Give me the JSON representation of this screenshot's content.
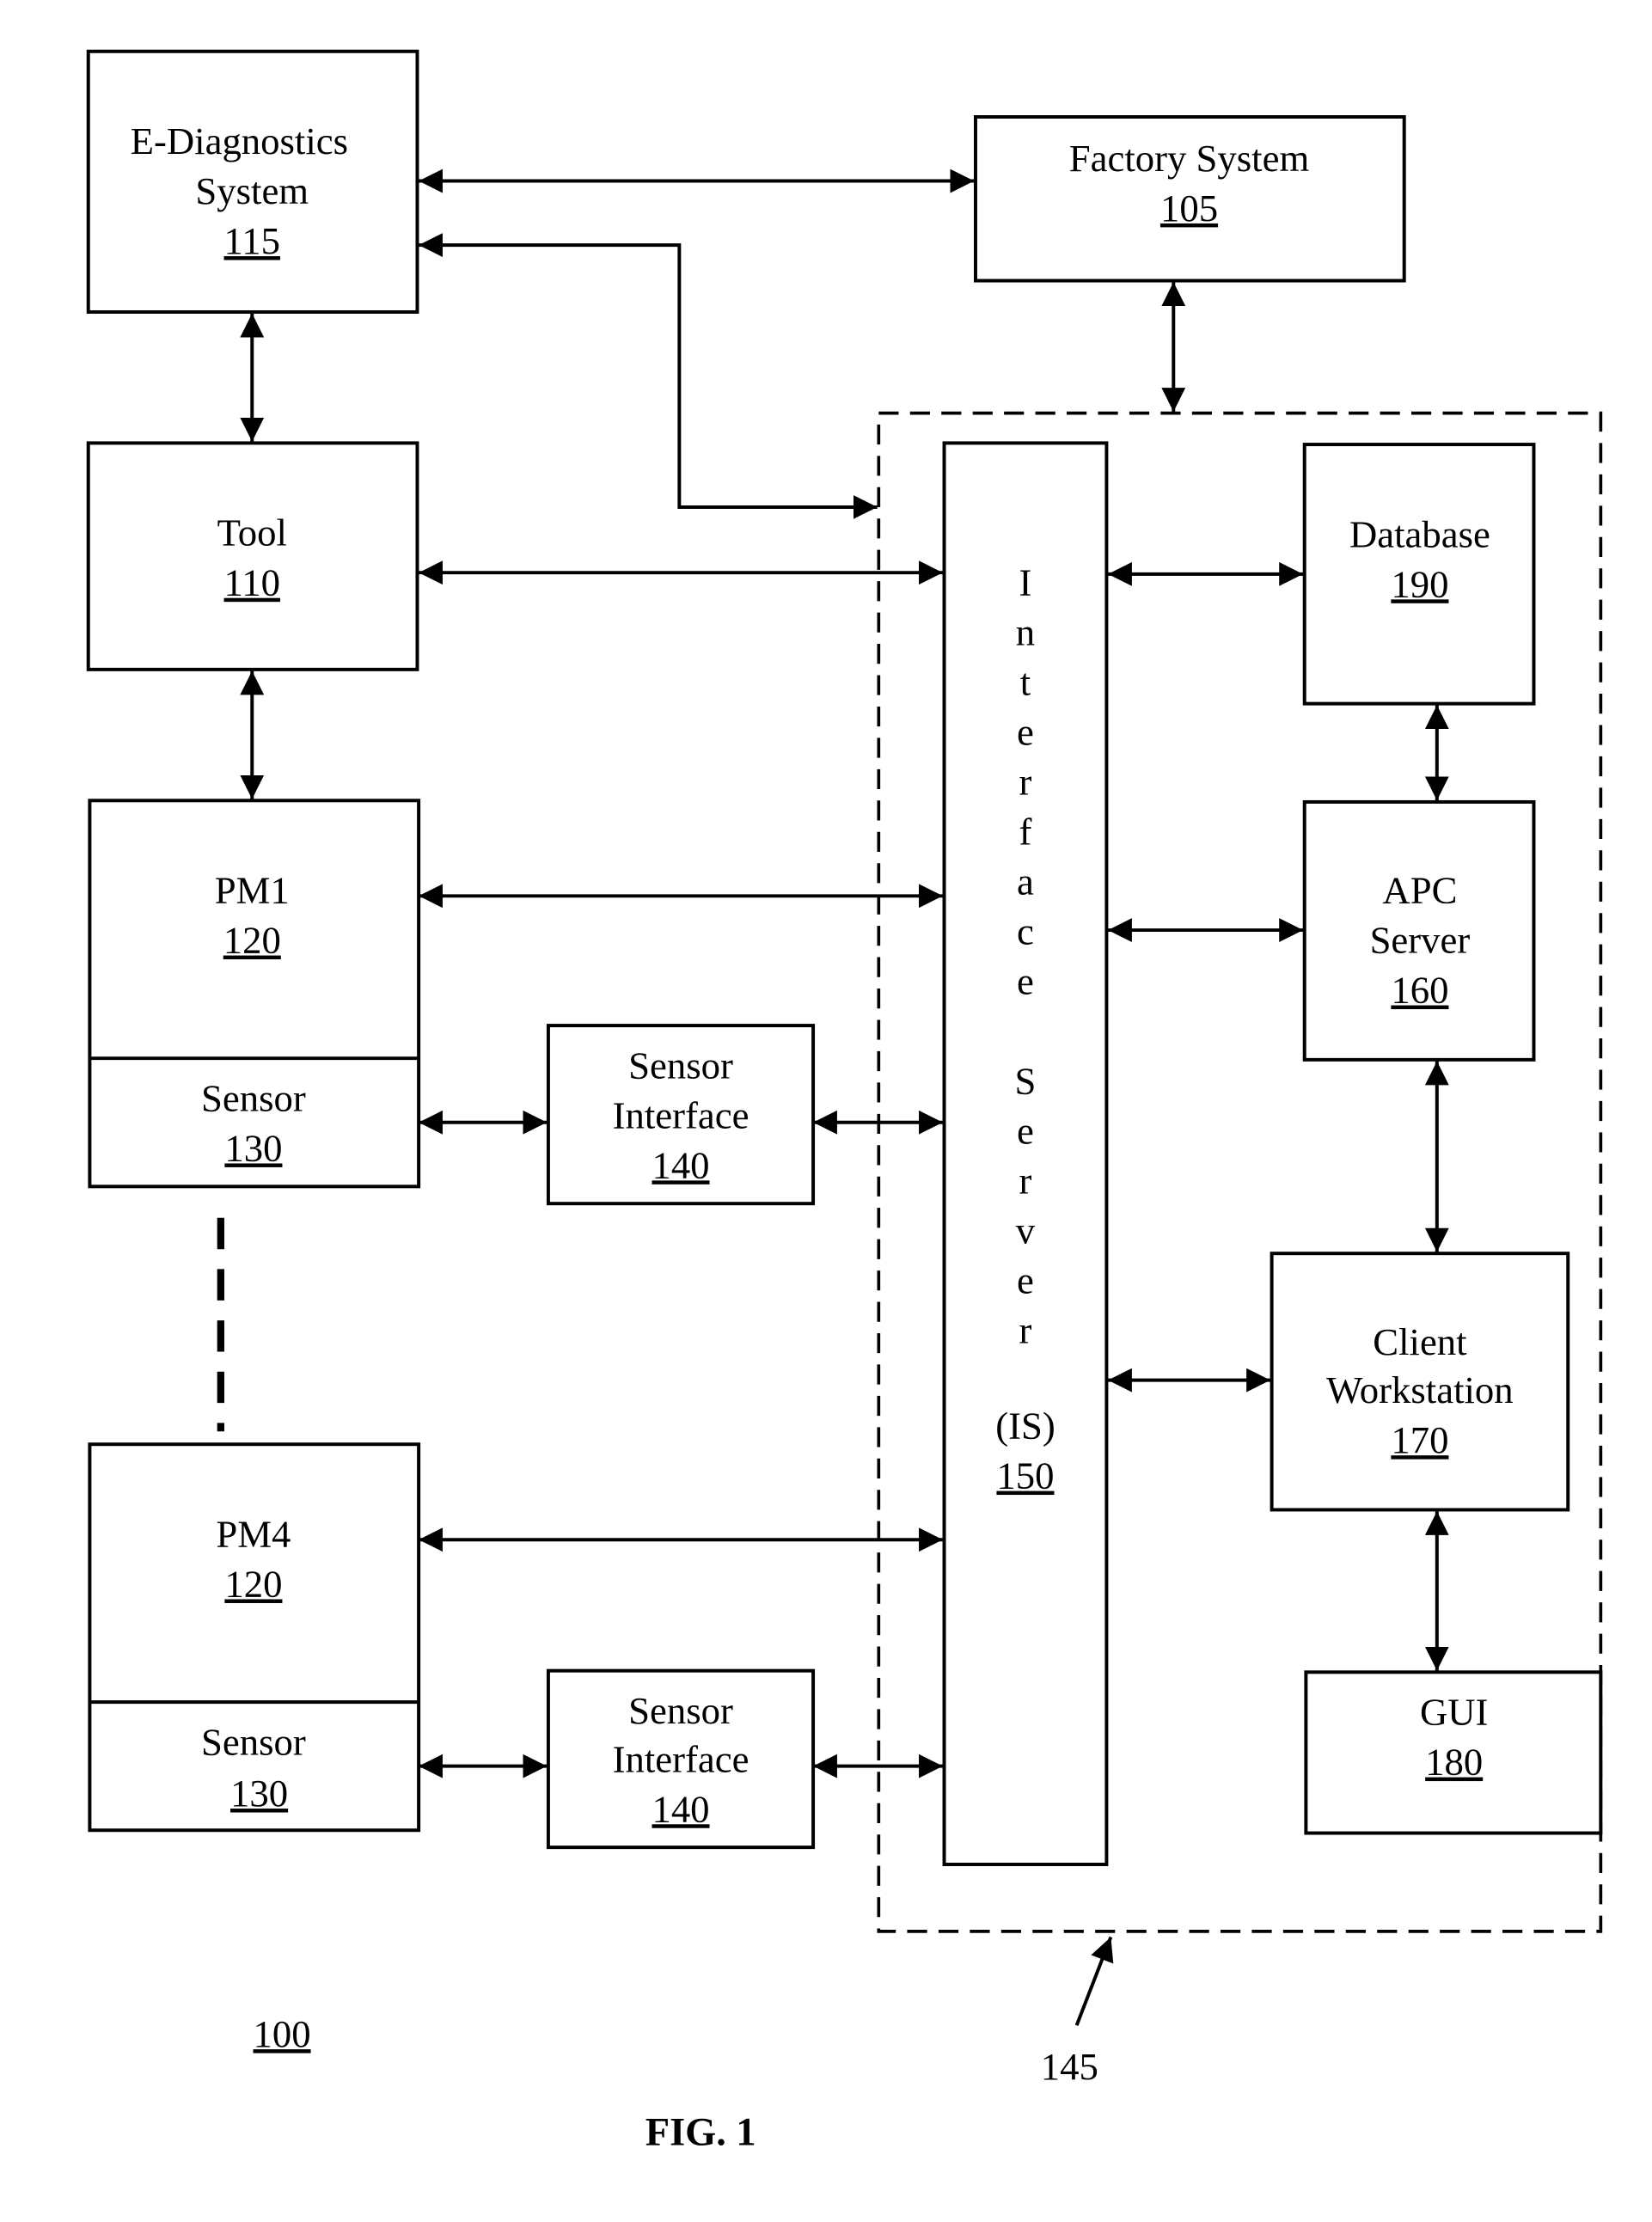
{
  "figure": {
    "caption": "FIG. 1",
    "system_ref": "100",
    "group_ref": "145"
  },
  "blocks": {
    "ediag": {
      "lines": [
        "E-Diagnostics",
        "System"
      ],
      "ref": "115"
    },
    "factory": {
      "lines": [
        "Factory System"
      ],
      "ref": "105"
    },
    "tool": {
      "lines": [
        "Tool"
      ],
      "ref": "110"
    },
    "pm1": {
      "lines": [
        "PM1"
      ],
      "ref": "120"
    },
    "sensor1": {
      "lines": [
        "Sensor"
      ],
      "ref": "130"
    },
    "sensorif1": {
      "lines": [
        "Sensor",
        "Interface"
      ],
      "ref": "140"
    },
    "pm4": {
      "lines": [
        "PM4"
      ],
      "ref": "120"
    },
    "sensor4": {
      "lines": [
        "Sensor"
      ],
      "ref": "130"
    },
    "sensorif4": {
      "lines": [
        "Sensor",
        "Interface"
      ],
      "ref": "140"
    },
    "is": {
      "letters": [
        "I",
        "n",
        "t",
        "e",
        "r",
        "f",
        "a",
        "c",
        "e",
        "S",
        "e",
        "r",
        "v",
        "e",
        "r"
      ],
      "abbr": "(IS)",
      "ref": "150"
    },
    "database": {
      "lines": [
        "Database"
      ],
      "ref": "190"
    },
    "apc": {
      "lines": [
        "APC",
        "Server"
      ],
      "ref": "160"
    },
    "client": {
      "lines": [
        "Client",
        "Workstation"
      ],
      "ref": "170"
    },
    "gui": {
      "lines": [
        "GUI"
      ],
      "ref": "180"
    }
  }
}
